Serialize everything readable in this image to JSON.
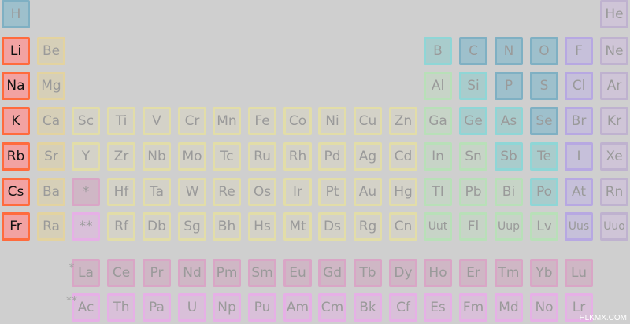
{
  "colors": {
    "nonmetal": {
      "bg": "#9ec0cc",
      "border": "#7fb0c3"
    },
    "noble": {
      "bg": "#cfc5d7",
      "border": "#bfb2cf"
    },
    "alkali": {
      "bg": "#f2a2a2",
      "border": "#ff6b3d"
    },
    "alkaline": {
      "bg": "#d6cfb8",
      "border": "#e3d3a0"
    },
    "transition": {
      "bg": "#d4d2c8",
      "border": "#e2dda8"
    },
    "post": {
      "bg": "#c7d4c7",
      "border": "#b8e0b8"
    },
    "metalloid": {
      "bg": "#a9cccc",
      "border": "#8fd6d6"
    },
    "halogen": {
      "bg": "#c6c0da",
      "border": "#b7a8e2"
    },
    "lanthanide": {
      "bg": "#cfb7c5",
      "border": "#d9a6c6"
    },
    "actinide": {
      "bg": "#d9c0d9",
      "border": "#e6b0e6"
    }
  },
  "elements": [
    {
      "symbol": "H",
      "row": 1,
      "col": 1,
      "cat": "nonmetal"
    },
    {
      "symbol": "He",
      "row": 1,
      "col": 18,
      "cat": "noble"
    },
    {
      "symbol": "Li",
      "row": 2,
      "col": 1,
      "cat": "alkali",
      "hl": true
    },
    {
      "symbol": "Be",
      "row": 2,
      "col": 2,
      "cat": "alkaline"
    },
    {
      "symbol": "B",
      "row": 2,
      "col": 13,
      "cat": "metalloid"
    },
    {
      "symbol": "C",
      "row": 2,
      "col": 14,
      "cat": "nonmetal"
    },
    {
      "symbol": "N",
      "row": 2,
      "col": 15,
      "cat": "nonmetal"
    },
    {
      "symbol": "O",
      "row": 2,
      "col": 16,
      "cat": "nonmetal"
    },
    {
      "symbol": "F",
      "row": 2,
      "col": 17,
      "cat": "halogen"
    },
    {
      "symbol": "Ne",
      "row": 2,
      "col": 18,
      "cat": "noble"
    },
    {
      "symbol": "Na",
      "row": 3,
      "col": 1,
      "cat": "alkali",
      "hl": true
    },
    {
      "symbol": "Mg",
      "row": 3,
      "col": 2,
      "cat": "alkaline"
    },
    {
      "symbol": "Al",
      "row": 3,
      "col": 13,
      "cat": "post"
    },
    {
      "symbol": "Si",
      "row": 3,
      "col": 14,
      "cat": "metalloid"
    },
    {
      "symbol": "P",
      "row": 3,
      "col": 15,
      "cat": "nonmetal"
    },
    {
      "symbol": "S",
      "row": 3,
      "col": 16,
      "cat": "nonmetal"
    },
    {
      "symbol": "Cl",
      "row": 3,
      "col": 17,
      "cat": "halogen"
    },
    {
      "symbol": "Ar",
      "row": 3,
      "col": 18,
      "cat": "noble"
    },
    {
      "symbol": "K",
      "row": 4,
      "col": 1,
      "cat": "alkali",
      "hl": true
    },
    {
      "symbol": "Ca",
      "row": 4,
      "col": 2,
      "cat": "alkaline"
    },
    {
      "symbol": "Sc",
      "row": 4,
      "col": 3,
      "cat": "transition"
    },
    {
      "symbol": "Ti",
      "row": 4,
      "col": 4,
      "cat": "transition"
    },
    {
      "symbol": "V",
      "row": 4,
      "col": 5,
      "cat": "transition"
    },
    {
      "symbol": "Cr",
      "row": 4,
      "col": 6,
      "cat": "transition"
    },
    {
      "symbol": "Mn",
      "row": 4,
      "col": 7,
      "cat": "transition"
    },
    {
      "symbol": "Fe",
      "row": 4,
      "col": 8,
      "cat": "transition"
    },
    {
      "symbol": "Co",
      "row": 4,
      "col": 9,
      "cat": "transition"
    },
    {
      "symbol": "Ni",
      "row": 4,
      "col": 10,
      "cat": "transition"
    },
    {
      "symbol": "Cu",
      "row": 4,
      "col": 11,
      "cat": "transition"
    },
    {
      "symbol": "Zn",
      "row": 4,
      "col": 12,
      "cat": "transition"
    },
    {
      "symbol": "Ga",
      "row": 4,
      "col": 13,
      "cat": "post"
    },
    {
      "symbol": "Ge",
      "row": 4,
      "col": 14,
      "cat": "metalloid"
    },
    {
      "symbol": "As",
      "row": 4,
      "col": 15,
      "cat": "metalloid"
    },
    {
      "symbol": "Se",
      "row": 4,
      "col": 16,
      "cat": "nonmetal"
    },
    {
      "symbol": "Br",
      "row": 4,
      "col": 17,
      "cat": "halogen"
    },
    {
      "symbol": "Kr",
      "row": 4,
      "col": 18,
      "cat": "noble"
    },
    {
      "symbol": "Rb",
      "row": 5,
      "col": 1,
      "cat": "alkali",
      "hl": true
    },
    {
      "symbol": "Sr",
      "row": 5,
      "col": 2,
      "cat": "alkaline"
    },
    {
      "symbol": "Y",
      "row": 5,
      "col": 3,
      "cat": "transition"
    },
    {
      "symbol": "Zr",
      "row": 5,
      "col": 4,
      "cat": "transition"
    },
    {
      "symbol": "Nb",
      "row": 5,
      "col": 5,
      "cat": "transition"
    },
    {
      "symbol": "Mo",
      "row": 5,
      "col": 6,
      "cat": "transition"
    },
    {
      "symbol": "Tc",
      "row": 5,
      "col": 7,
      "cat": "transition"
    },
    {
      "symbol": "Ru",
      "row": 5,
      "col": 8,
      "cat": "transition"
    },
    {
      "symbol": "Rh",
      "row": 5,
      "col": 9,
      "cat": "transition"
    },
    {
      "symbol": "Pd",
      "row": 5,
      "col": 10,
      "cat": "transition"
    },
    {
      "symbol": "Ag",
      "row": 5,
      "col": 11,
      "cat": "transition"
    },
    {
      "symbol": "Cd",
      "row": 5,
      "col": 12,
      "cat": "transition"
    },
    {
      "symbol": "In",
      "row": 5,
      "col": 13,
      "cat": "post"
    },
    {
      "symbol": "Sn",
      "row": 5,
      "col": 14,
      "cat": "post"
    },
    {
      "symbol": "Sb",
      "row": 5,
      "col": 15,
      "cat": "metalloid"
    },
    {
      "symbol": "Te",
      "row": 5,
      "col": 16,
      "cat": "metalloid"
    },
    {
      "symbol": "I",
      "row": 5,
      "col": 17,
      "cat": "halogen"
    },
    {
      "symbol": "Xe",
      "row": 5,
      "col": 18,
      "cat": "noble"
    },
    {
      "symbol": "Cs",
      "row": 6,
      "col": 1,
      "cat": "alkali",
      "hl": true
    },
    {
      "symbol": "Ba",
      "row": 6,
      "col": 2,
      "cat": "alkaline"
    },
    {
      "symbol": "*",
      "row": 6,
      "col": 3,
      "cat": "lanthanide"
    },
    {
      "symbol": "Hf",
      "row": 6,
      "col": 4,
      "cat": "transition"
    },
    {
      "symbol": "Ta",
      "row": 6,
      "col": 5,
      "cat": "transition"
    },
    {
      "symbol": "W",
      "row": 6,
      "col": 6,
      "cat": "transition"
    },
    {
      "symbol": "Re",
      "row": 6,
      "col": 7,
      "cat": "transition"
    },
    {
      "symbol": "Os",
      "row": 6,
      "col": 8,
      "cat": "transition"
    },
    {
      "symbol": "Ir",
      "row": 6,
      "col": 9,
      "cat": "transition"
    },
    {
      "symbol": "Pt",
      "row": 6,
      "col": 10,
      "cat": "transition"
    },
    {
      "symbol": "Au",
      "row": 6,
      "col": 11,
      "cat": "transition"
    },
    {
      "symbol": "Hg",
      "row": 6,
      "col": 12,
      "cat": "transition"
    },
    {
      "symbol": "Tl",
      "row": 6,
      "col": 13,
      "cat": "post"
    },
    {
      "symbol": "Pb",
      "row": 6,
      "col": 14,
      "cat": "post"
    },
    {
      "symbol": "Bi",
      "row": 6,
      "col": 15,
      "cat": "post"
    },
    {
      "symbol": "Po",
      "row": 6,
      "col": 16,
      "cat": "metalloid"
    },
    {
      "symbol": "At",
      "row": 6,
      "col": 17,
      "cat": "halogen"
    },
    {
      "symbol": "Rn",
      "row": 6,
      "col": 18,
      "cat": "noble"
    },
    {
      "symbol": "Fr",
      "row": 7,
      "col": 1,
      "cat": "alkali",
      "hl": true
    },
    {
      "symbol": "Ra",
      "row": 7,
      "col": 2,
      "cat": "alkaline"
    },
    {
      "symbol": "**",
      "row": 7,
      "col": 3,
      "cat": "actinide"
    },
    {
      "symbol": "Rf",
      "row": 7,
      "col": 4,
      "cat": "transition"
    },
    {
      "symbol": "Db",
      "row": 7,
      "col": 5,
      "cat": "transition"
    },
    {
      "symbol": "Sg",
      "row": 7,
      "col": 6,
      "cat": "transition"
    },
    {
      "symbol": "Bh",
      "row": 7,
      "col": 7,
      "cat": "transition"
    },
    {
      "symbol": "Hs",
      "row": 7,
      "col": 8,
      "cat": "transition"
    },
    {
      "symbol": "Mt",
      "row": 7,
      "col": 9,
      "cat": "transition"
    },
    {
      "symbol": "Ds",
      "row": 7,
      "col": 10,
      "cat": "transition"
    },
    {
      "symbol": "Rg",
      "row": 7,
      "col": 11,
      "cat": "transition"
    },
    {
      "symbol": "Cn",
      "row": 7,
      "col": 12,
      "cat": "transition"
    },
    {
      "symbol": "Uut",
      "row": 7,
      "col": 13,
      "cat": "post",
      "small": true
    },
    {
      "symbol": "Fl",
      "row": 7,
      "col": 14,
      "cat": "post"
    },
    {
      "symbol": "Uup",
      "row": 7,
      "col": 15,
      "cat": "post",
      "small": true
    },
    {
      "symbol": "Lv",
      "row": 7,
      "col": 16,
      "cat": "post"
    },
    {
      "symbol": "Uus",
      "row": 7,
      "col": 17,
      "cat": "halogen",
      "small": true
    },
    {
      "symbol": "Uuo",
      "row": 7,
      "col": 18,
      "cat": "noble",
      "small": true
    },
    {
      "symbol": "La",
      "row": 8,
      "col": 3,
      "cat": "lanthanide"
    },
    {
      "symbol": "Ce",
      "row": 8,
      "col": 4,
      "cat": "lanthanide"
    },
    {
      "symbol": "Pr",
      "row": 8,
      "col": 5,
      "cat": "lanthanide"
    },
    {
      "symbol": "Nd",
      "row": 8,
      "col": 6,
      "cat": "lanthanide"
    },
    {
      "symbol": "Pm",
      "row": 8,
      "col": 7,
      "cat": "lanthanide"
    },
    {
      "symbol": "Sm",
      "row": 8,
      "col": 8,
      "cat": "lanthanide"
    },
    {
      "symbol": "Eu",
      "row": 8,
      "col": 9,
      "cat": "lanthanide"
    },
    {
      "symbol": "Gd",
      "row": 8,
      "col": 10,
      "cat": "lanthanide"
    },
    {
      "symbol": "Tb",
      "row": 8,
      "col": 11,
      "cat": "lanthanide"
    },
    {
      "symbol": "Dy",
      "row": 8,
      "col": 12,
      "cat": "lanthanide"
    },
    {
      "symbol": "Ho",
      "row": 8,
      "col": 13,
      "cat": "lanthanide"
    },
    {
      "symbol": "Er",
      "row": 8,
      "col": 14,
      "cat": "lanthanide"
    },
    {
      "symbol": "Tm",
      "row": 8,
      "col": 15,
      "cat": "lanthanide"
    },
    {
      "symbol": "Yb",
      "row": 8,
      "col": 16,
      "cat": "lanthanide"
    },
    {
      "symbol": "Lu",
      "row": 8,
      "col": 17,
      "cat": "lanthanide"
    },
    {
      "symbol": "Ac",
      "row": 9,
      "col": 3,
      "cat": "actinide"
    },
    {
      "symbol": "Th",
      "row": 9,
      "col": 4,
      "cat": "actinide"
    },
    {
      "symbol": "Pa",
      "row": 9,
      "col": 5,
      "cat": "actinide"
    },
    {
      "symbol": "U",
      "row": 9,
      "col": 6,
      "cat": "actinide"
    },
    {
      "symbol": "Np",
      "row": 9,
      "col": 7,
      "cat": "actinide"
    },
    {
      "symbol": "Pu",
      "row": 9,
      "col": 8,
      "cat": "actinide"
    },
    {
      "symbol": "Am",
      "row": 9,
      "col": 9,
      "cat": "actinide"
    },
    {
      "symbol": "Cm",
      "row": 9,
      "col": 10,
      "cat": "actinide"
    },
    {
      "symbol": "Bk",
      "row": 9,
      "col": 11,
      "cat": "actinide"
    },
    {
      "symbol": "Cf",
      "row": 9,
      "col": 12,
      "cat": "actinide"
    },
    {
      "symbol": "Es",
      "row": 9,
      "col": 13,
      "cat": "actinide"
    },
    {
      "symbol": "Fm",
      "row": 9,
      "col": 14,
      "cat": "actinide"
    },
    {
      "symbol": "Md",
      "row": 9,
      "col": 15,
      "cat": "actinide"
    },
    {
      "symbol": "No",
      "row": 9,
      "col": 16,
      "cat": "actinide"
    },
    {
      "symbol": "Lr",
      "row": 9,
      "col": 17,
      "cat": "actinide"
    }
  ],
  "markers": {
    "lanthanide": "*",
    "actinide": "**"
  },
  "credit": "HLKMX.COM"
}
